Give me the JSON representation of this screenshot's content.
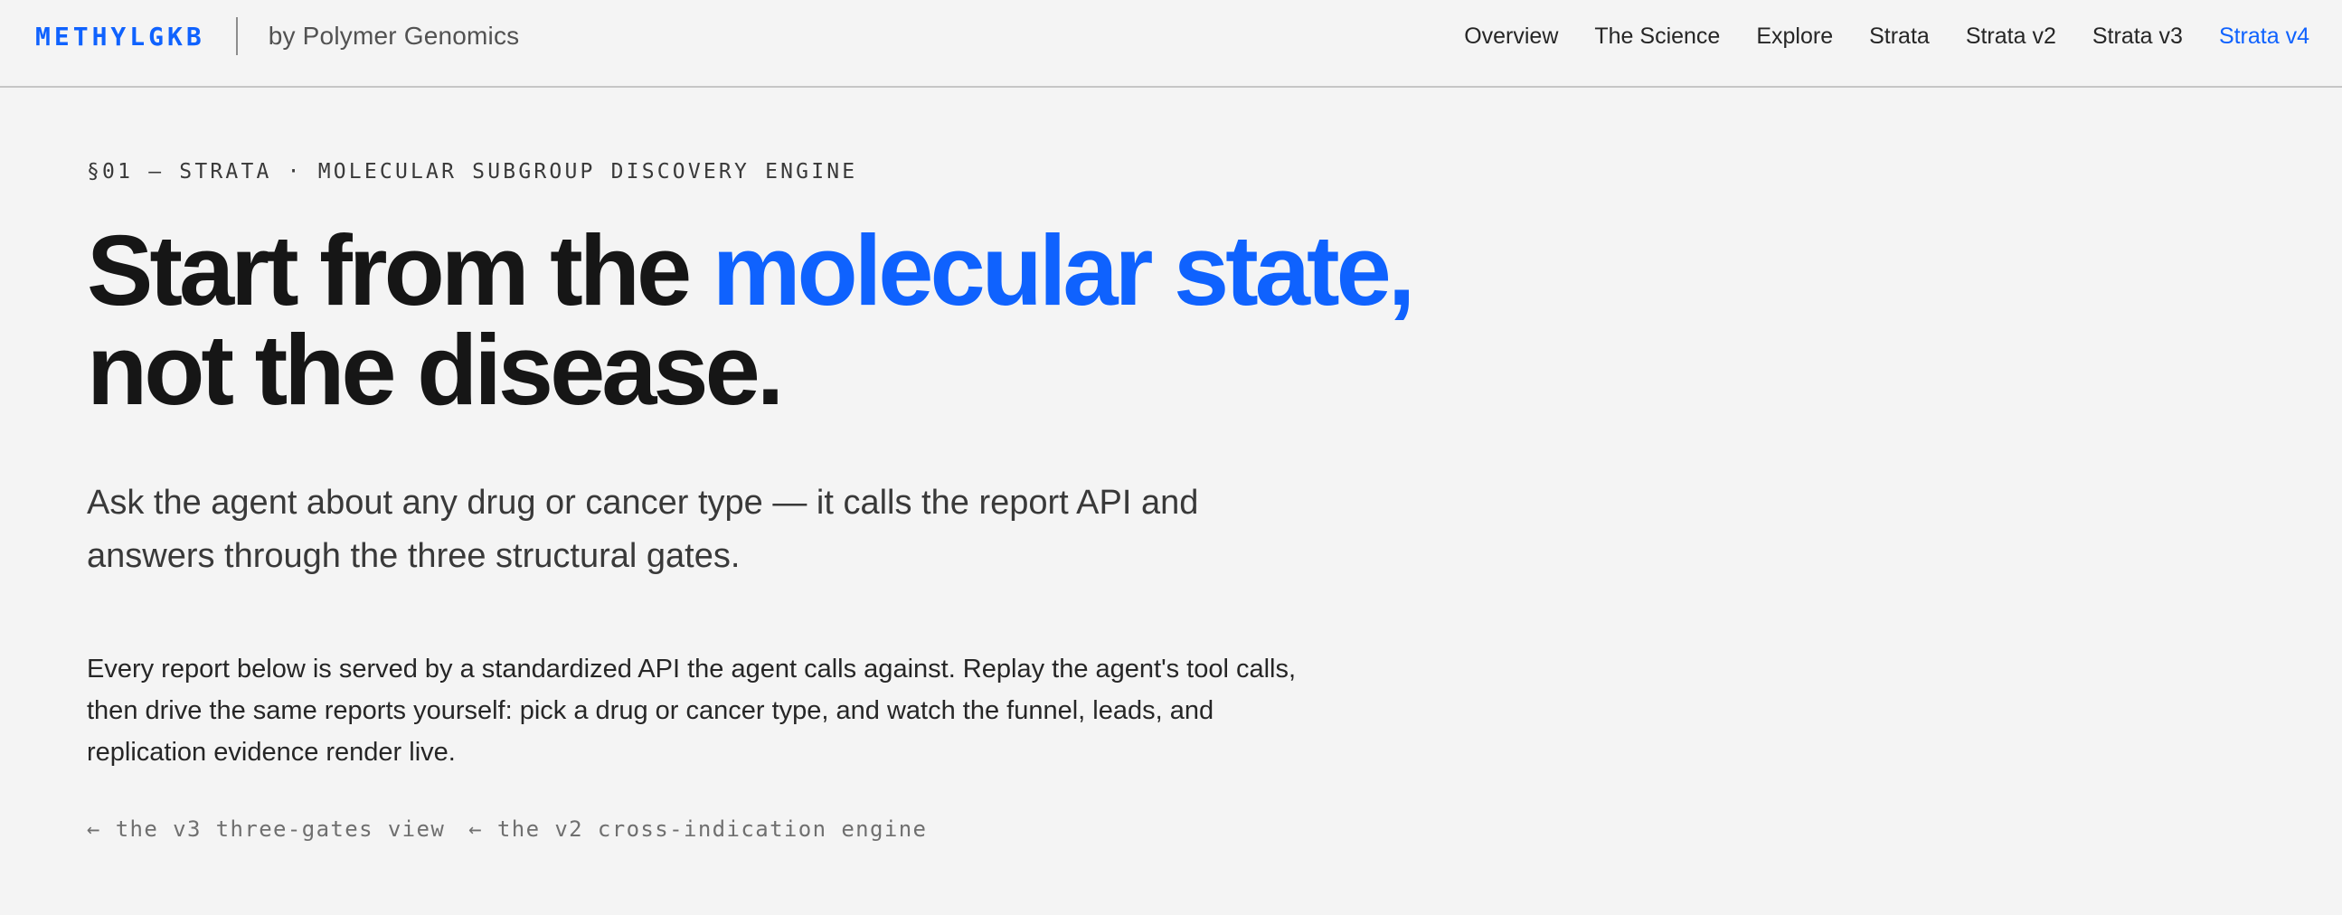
{
  "header": {
    "brand": "METHYLGKB",
    "byline": "by Polymer Genomics",
    "nav": [
      {
        "label": "Overview"
      },
      {
        "label": "The Science"
      },
      {
        "label": "Explore"
      },
      {
        "label": "Strata"
      },
      {
        "label": "Strata v2"
      },
      {
        "label": "Strata v3"
      },
      {
        "label": "Strata v4",
        "active": true
      }
    ]
  },
  "hero": {
    "eyebrow": "§01 — STRATA · MOLECULAR SUBGROUP DISCOVERY ENGINE",
    "headline": {
      "part1": "Start from the ",
      "accent": "molecular state,",
      "line2": "not the disease."
    },
    "lede": "Ask the agent about any drug or cancer type — it calls the report API and answers through the three structural gates.",
    "body": "Every report below is served by a standardized API the agent calls against. Replay the agent's tool calls, then drive the same reports yourself: pick a drug or cancer type, and watch the funnel, leads, and replication evidence render live.",
    "back_links": [
      {
        "label": "← the v3 three-gates view"
      },
      {
        "label": "← the v2 cross-indication engine"
      }
    ]
  },
  "colors": {
    "accent": "#0f62fe",
    "background": "#f4f4f4",
    "text": "#161616"
  }
}
